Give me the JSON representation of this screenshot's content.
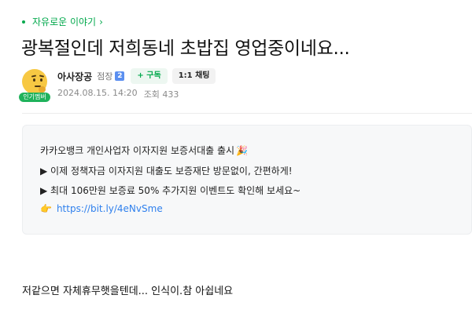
{
  "board": {
    "label": "자유로운 이야기",
    "chevron": "chevron-right-icon"
  },
  "post": {
    "title": "광복절인데 저희동네 초밥집 영업중이네요...",
    "author": {
      "nickname": "아사장공",
      "role": "점장",
      "role_icon_text": "2",
      "level_badge": "인기멤버",
      "subscribe_label": "+ 구독",
      "chat_label": "1:1 채팅"
    },
    "date": "2024.08.15. 14:20",
    "views": "조회 433",
    "body": "저같으면 자체휴무햇을텐데... 인식이.참 아쉽네요"
  },
  "promo": {
    "line1": "카카오뱅크 개인사업자 이자지원 보증서대출 출시",
    "line2": "▶ 이제 정책자금 이자지원 대출도 보증재단 방문없이, 간편하게!",
    "line3": "▶ 최대 106만원 보증료 50% 추가지원 이벤트도 확인해 보세요~",
    "link": "https://bit.ly/4eNvSme"
  },
  "colors": {
    "accent": "#03a94d",
    "link": "#2f80ed"
  }
}
